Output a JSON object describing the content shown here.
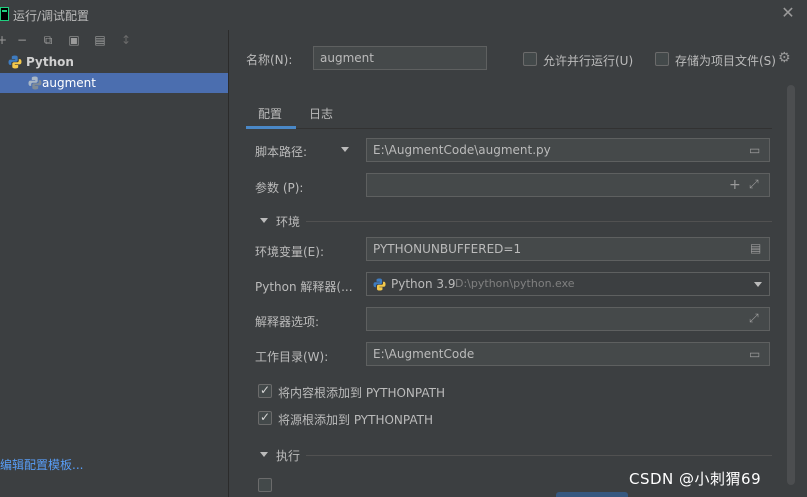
{
  "window": {
    "title": "运行/调试配置",
    "close_glyph": "✕"
  },
  "toolbar": {
    "add": "+",
    "remove": "−",
    "copy": "⧉",
    "save": "▣",
    "folder": "▤",
    "sort": "↕"
  },
  "tree": {
    "group_label": "Python",
    "item_label": "augment",
    "edit_templates_link": "编辑配置模板..."
  },
  "header": {
    "name_label": "名称(N):",
    "name_value": "augment",
    "allow_parallel_label": "允许并行运行(U)",
    "allow_parallel_checked": false,
    "store_as_file_label": "存储为项目文件(S)",
    "store_as_file_checked": false
  },
  "tabs": [
    {
      "label": "配置",
      "active": true
    },
    {
      "label": "日志",
      "active": false
    }
  ],
  "form": {
    "script_path_label": "脚本路径:",
    "script_path_value": "E:\\AugmentCode\\augment.py",
    "params_label": "参数 (P):",
    "params_value": "",
    "env_section": "环境",
    "env_vars_label": "环境变量(E):",
    "env_vars_value": "PYTHONUNBUFFERED=1",
    "interpreter_label": "Python 解释器(...",
    "interpreter_name": "Python 3.9",
    "interpreter_path": "D:\\python\\python.exe",
    "interp_options_label": "解释器选项:",
    "interp_options_value": "",
    "workdir_label": "工作目录(W):",
    "workdir_value": "E:\\AugmentCode",
    "add_content_roots_label": "将内容根添加到 PYTHONPATH",
    "add_content_roots_checked": true,
    "add_source_roots_label": "将源根添加到 PYTHONPATH",
    "add_source_roots_checked": true,
    "exec_section": "执行"
  },
  "watermark": "CSDN @小刺猬69"
}
